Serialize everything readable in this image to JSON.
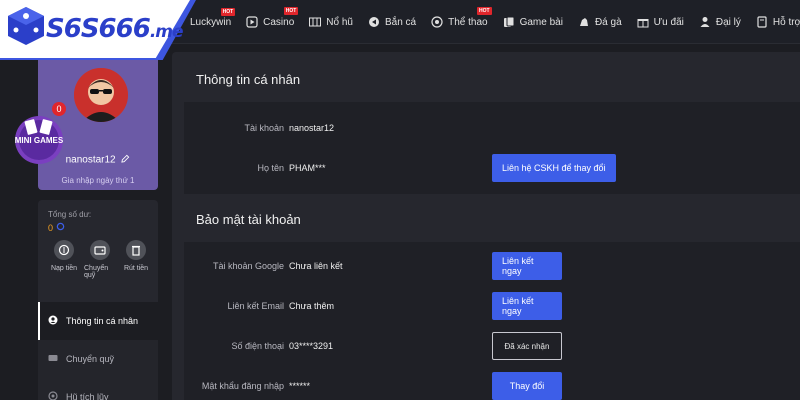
{
  "brand": {
    "logo_text": "S6S666",
    "logo_suffix": ".me"
  },
  "nav": [
    {
      "label": "Luckywin",
      "icon": "lucky-icon",
      "hot": true,
      "hot_label": "HOT"
    },
    {
      "label": "Casino",
      "icon": "play-icon",
      "hot": true,
      "hot_label": "HOT"
    },
    {
      "label": "Nổ hũ",
      "icon": "slot-icon",
      "hot": false
    },
    {
      "label": "Bắn cá",
      "icon": "fish-icon",
      "hot": false
    },
    {
      "label": "Thể thao",
      "icon": "ball-icon",
      "hot": true,
      "hot_label": "HOT"
    },
    {
      "label": "Game bài",
      "icon": "cards-icon",
      "hot": false
    },
    {
      "label": "Đá gà",
      "icon": "rooster-icon",
      "hot": false
    },
    {
      "label": "Ưu đãi",
      "icon": "gift-icon",
      "hot": false
    },
    {
      "label": "Đại lý",
      "icon": "agent-icon",
      "hot": false
    },
    {
      "label": "Hỗ trợ",
      "icon": "book-icon",
      "hot": false
    }
  ],
  "profile": {
    "username": "nanostar12",
    "join_info": "Gia nhập ngày thứ 1",
    "minigames_label": "MINI GAMES",
    "minigames_badge": "0"
  },
  "balance": {
    "label": "Tổng số dư:",
    "value": "0",
    "actions": [
      {
        "label": "Nạp tiền",
        "icon": "deposit-icon"
      },
      {
        "label": "Chuyển quỹ",
        "icon": "wallet-icon"
      },
      {
        "label": "Rút tiền",
        "icon": "withdraw-icon"
      }
    ]
  },
  "menu": [
    {
      "label": "Thông tin cá nhân",
      "icon": "user-icon",
      "active": true
    },
    {
      "label": "Chuyển quỹ",
      "icon": "wallet-icon",
      "active": false
    },
    {
      "label": "Hũ tích lũy",
      "icon": "jar-icon",
      "active": false
    }
  ],
  "personal": {
    "title": "Thông tin cá nhân",
    "account_label": "Tài khoản",
    "account_value": "nanostar12",
    "name_label": "Họ tên",
    "name_value": "PHAM***",
    "contact_button": "Liên hệ CSKH để thay đổi"
  },
  "security": {
    "title": "Bảo mật tài khoản",
    "rows": [
      {
        "label": "Tài khoản Google",
        "value": "Chưa liên kết",
        "button": "Liên kết ngay",
        "style": "primary"
      },
      {
        "label": "Liên kết Email",
        "value": "Chưa thêm",
        "button": "Liên kết ngay",
        "style": "primary"
      },
      {
        "label": "Số điện thoại",
        "value": "03****3291",
        "button": "Đã xác nhận",
        "style": "outline"
      },
      {
        "label": "Mật khẩu đăng nhập",
        "value": "******",
        "button": "Thay đổi",
        "style": "primary"
      }
    ]
  },
  "colors": {
    "accent": "#3d5ee8",
    "brand_blue": "#2b3fc9",
    "hot": "#e0262c",
    "profile_card": "#6b5aa6",
    "balance": "#f2a124"
  }
}
